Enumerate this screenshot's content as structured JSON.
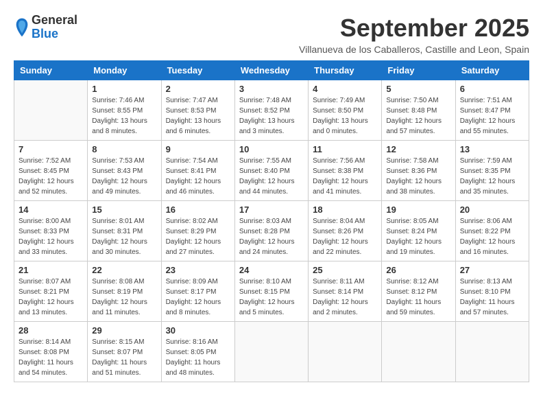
{
  "logo": {
    "general": "General",
    "blue": "Blue"
  },
  "title": "September 2025",
  "subtitle": "Villanueva de los Caballeros, Castille and Leon, Spain",
  "weekdays": [
    "Sunday",
    "Monday",
    "Tuesday",
    "Wednesday",
    "Thursday",
    "Friday",
    "Saturday"
  ],
  "weeks": [
    [
      {
        "day": "",
        "info": ""
      },
      {
        "day": "1",
        "info": "Sunrise: 7:46 AM\nSunset: 8:55 PM\nDaylight: 13 hours\nand 8 minutes."
      },
      {
        "day": "2",
        "info": "Sunrise: 7:47 AM\nSunset: 8:53 PM\nDaylight: 13 hours\nand 6 minutes."
      },
      {
        "day": "3",
        "info": "Sunrise: 7:48 AM\nSunset: 8:52 PM\nDaylight: 13 hours\nand 3 minutes."
      },
      {
        "day": "4",
        "info": "Sunrise: 7:49 AM\nSunset: 8:50 PM\nDaylight: 13 hours\nand 0 minutes."
      },
      {
        "day": "5",
        "info": "Sunrise: 7:50 AM\nSunset: 8:48 PM\nDaylight: 12 hours\nand 57 minutes."
      },
      {
        "day": "6",
        "info": "Sunrise: 7:51 AM\nSunset: 8:47 PM\nDaylight: 12 hours\nand 55 minutes."
      }
    ],
    [
      {
        "day": "7",
        "info": "Sunrise: 7:52 AM\nSunset: 8:45 PM\nDaylight: 12 hours\nand 52 minutes."
      },
      {
        "day": "8",
        "info": "Sunrise: 7:53 AM\nSunset: 8:43 PM\nDaylight: 12 hours\nand 49 minutes."
      },
      {
        "day": "9",
        "info": "Sunrise: 7:54 AM\nSunset: 8:41 PM\nDaylight: 12 hours\nand 46 minutes."
      },
      {
        "day": "10",
        "info": "Sunrise: 7:55 AM\nSunset: 8:40 PM\nDaylight: 12 hours\nand 44 minutes."
      },
      {
        "day": "11",
        "info": "Sunrise: 7:56 AM\nSunset: 8:38 PM\nDaylight: 12 hours\nand 41 minutes."
      },
      {
        "day": "12",
        "info": "Sunrise: 7:58 AM\nSunset: 8:36 PM\nDaylight: 12 hours\nand 38 minutes."
      },
      {
        "day": "13",
        "info": "Sunrise: 7:59 AM\nSunset: 8:35 PM\nDaylight: 12 hours\nand 35 minutes."
      }
    ],
    [
      {
        "day": "14",
        "info": "Sunrise: 8:00 AM\nSunset: 8:33 PM\nDaylight: 12 hours\nand 33 minutes."
      },
      {
        "day": "15",
        "info": "Sunrise: 8:01 AM\nSunset: 8:31 PM\nDaylight: 12 hours\nand 30 minutes."
      },
      {
        "day": "16",
        "info": "Sunrise: 8:02 AM\nSunset: 8:29 PM\nDaylight: 12 hours\nand 27 minutes."
      },
      {
        "day": "17",
        "info": "Sunrise: 8:03 AM\nSunset: 8:28 PM\nDaylight: 12 hours\nand 24 minutes."
      },
      {
        "day": "18",
        "info": "Sunrise: 8:04 AM\nSunset: 8:26 PM\nDaylight: 12 hours\nand 22 minutes."
      },
      {
        "day": "19",
        "info": "Sunrise: 8:05 AM\nSunset: 8:24 PM\nDaylight: 12 hours\nand 19 minutes."
      },
      {
        "day": "20",
        "info": "Sunrise: 8:06 AM\nSunset: 8:22 PM\nDaylight: 12 hours\nand 16 minutes."
      }
    ],
    [
      {
        "day": "21",
        "info": "Sunrise: 8:07 AM\nSunset: 8:21 PM\nDaylight: 12 hours\nand 13 minutes."
      },
      {
        "day": "22",
        "info": "Sunrise: 8:08 AM\nSunset: 8:19 PM\nDaylight: 12 hours\nand 11 minutes."
      },
      {
        "day": "23",
        "info": "Sunrise: 8:09 AM\nSunset: 8:17 PM\nDaylight: 12 hours\nand 8 minutes."
      },
      {
        "day": "24",
        "info": "Sunrise: 8:10 AM\nSunset: 8:15 PM\nDaylight: 12 hours\nand 5 minutes."
      },
      {
        "day": "25",
        "info": "Sunrise: 8:11 AM\nSunset: 8:14 PM\nDaylight: 12 hours\nand 2 minutes."
      },
      {
        "day": "26",
        "info": "Sunrise: 8:12 AM\nSunset: 8:12 PM\nDaylight: 11 hours\nand 59 minutes."
      },
      {
        "day": "27",
        "info": "Sunrise: 8:13 AM\nSunset: 8:10 PM\nDaylight: 11 hours\nand 57 minutes."
      }
    ],
    [
      {
        "day": "28",
        "info": "Sunrise: 8:14 AM\nSunset: 8:08 PM\nDaylight: 11 hours\nand 54 minutes."
      },
      {
        "day": "29",
        "info": "Sunrise: 8:15 AM\nSunset: 8:07 PM\nDaylight: 11 hours\nand 51 minutes."
      },
      {
        "day": "30",
        "info": "Sunrise: 8:16 AM\nSunset: 8:05 PM\nDaylight: 11 hours\nand 48 minutes."
      },
      {
        "day": "",
        "info": ""
      },
      {
        "day": "",
        "info": ""
      },
      {
        "day": "",
        "info": ""
      },
      {
        "day": "",
        "info": ""
      }
    ]
  ]
}
